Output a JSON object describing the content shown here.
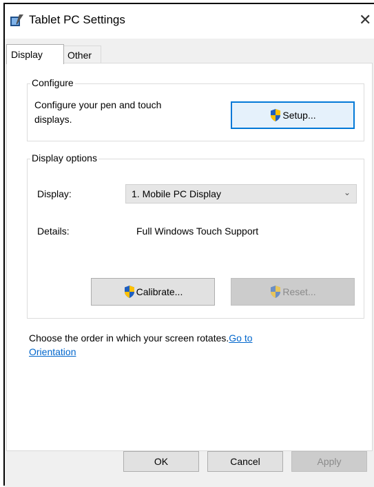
{
  "window": {
    "title": "Tablet PC Settings",
    "close_glyph": "✕",
    "app_icon": "tablet-pc-settings-icon"
  },
  "tabs": [
    {
      "label": "Display",
      "selected": true
    },
    {
      "label": "Other",
      "selected": false
    }
  ],
  "configure": {
    "group_label": "Configure",
    "description_line1": "Configure your pen and touch",
    "description_line2": "displays.",
    "setup_label": "Setup...",
    "setup_icon": "uac-shield-icon"
  },
  "display_options": {
    "group_label": "Display options",
    "display_label": "Display:",
    "display_value": "1. Mobile PC Display",
    "details_label": "Details:",
    "details_value": "Full Windows Touch Support",
    "calibrate_label": "Calibrate...",
    "reset_label": "Reset..."
  },
  "orientation": {
    "text": "Choose the order in which your screen rotates.",
    "link_line1": "Go to",
    "link_line2": "Orientation"
  },
  "footer": {
    "ok_label": "OK",
    "cancel_label": "Cancel",
    "apply_label": "Apply"
  },
  "colors": {
    "accent": "#0078d7",
    "link": "#0066cc",
    "dialog_bg": "#f0f0f0",
    "disabled_button": "#cccccc"
  }
}
